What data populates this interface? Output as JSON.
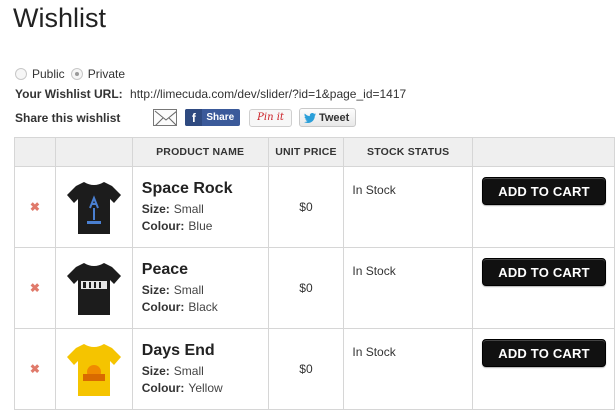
{
  "page": {
    "title": "Wishlist"
  },
  "privacy": {
    "options": [
      {
        "label": "Public",
        "checked": false
      },
      {
        "label": "Private",
        "checked": true
      }
    ]
  },
  "url_row": {
    "label": "Your Wishlist URL:",
    "value": "http://limecuda.com/dev/slider/?id=1&page_id=1417"
  },
  "share": {
    "label": "Share this wishlist",
    "facebook": "Share",
    "pinterest": "Pin it",
    "twitter": "Tweet"
  },
  "table": {
    "headers": {
      "name": "PRODUCT NAME",
      "price": "UNIT PRICE",
      "stock": "STOCK STATUS"
    },
    "rows": [
      {
        "remove": "✖",
        "name": "Space Rock",
        "size_label": "Size:",
        "size": "Small",
        "colour_label": "Colour:",
        "colour": "Blue",
        "price": "$0",
        "stock": "In Stock",
        "button": "ADD TO CART",
        "shirt_color": "#1c1c1c",
        "print": "space-rock"
      },
      {
        "remove": "✖",
        "name": "Peace",
        "size_label": "Size:",
        "size": "Small",
        "colour_label": "Colour:",
        "colour": "Black",
        "price": "$0",
        "stock": "In Stock",
        "button": "ADD TO CART",
        "shirt_color": "#1c1c1c",
        "print": "peace"
      },
      {
        "remove": "✖",
        "name": "Days End",
        "size_label": "Size:",
        "size": "Small",
        "colour_label": "Colour:",
        "colour": "Yellow",
        "price": "$0",
        "stock": "In Stock",
        "button": "ADD TO CART",
        "shirt_color": "#f5c400",
        "print": "sunset"
      }
    ]
  }
}
